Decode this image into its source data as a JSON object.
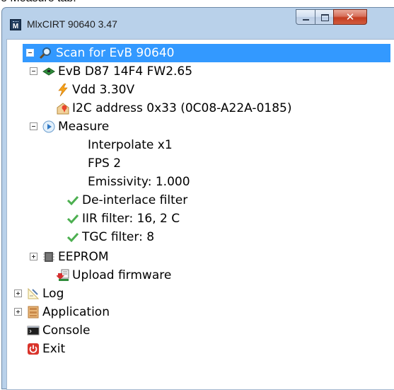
{
  "caption": "e Measure tab.",
  "window": {
    "title": "MlxCIRT 90640 3.47"
  },
  "tree": {
    "scan": "Scan for EvB 90640",
    "evb": "EvB D87 14F4 FW2.65",
    "vdd": "Vdd 3.30V",
    "i2c": "I2C address 0x33 (0C08-A22A-0185)",
    "measure": "Measure",
    "interpolate": "Interpolate x1",
    "fps": "FPS 2",
    "emissivity": "Emissivity: 1.000",
    "deinterlace": "De-interlace filter",
    "iir": "IIR filter: 16, 2 C",
    "tgc": "TGC filter: 8",
    "eeprom": "EEPROM",
    "upload": "Upload firmware",
    "log": "Log",
    "application": "Application",
    "console": "Console",
    "exit": "Exit"
  }
}
